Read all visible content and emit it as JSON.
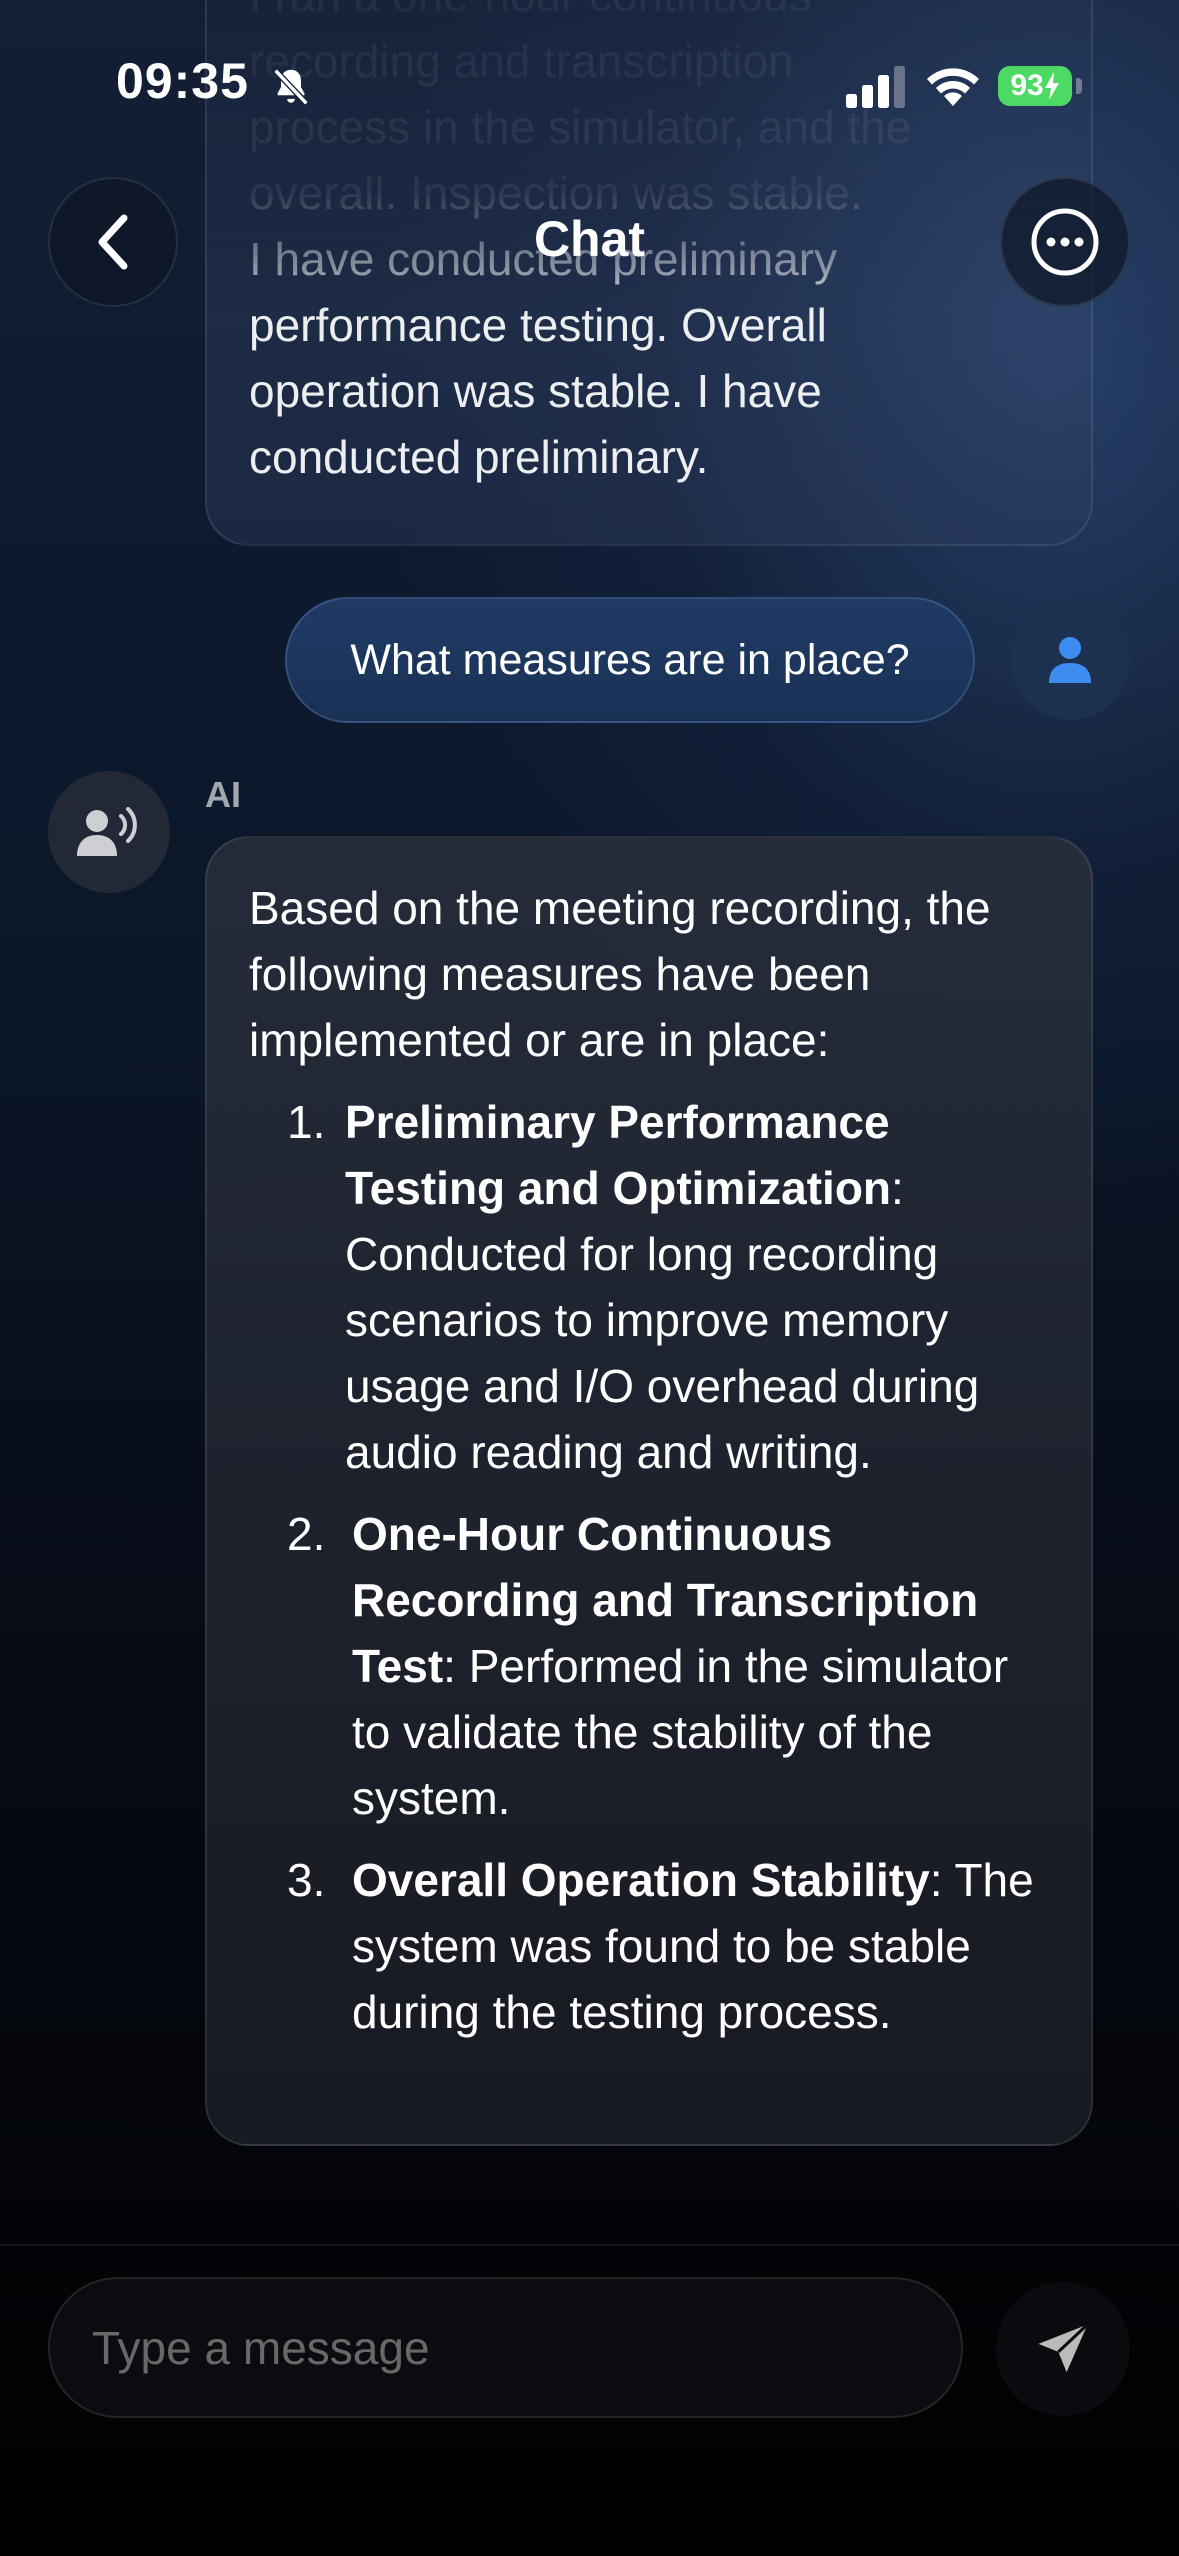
{
  "status_bar": {
    "time": "09:35",
    "battery_level": "93"
  },
  "header": {
    "title": "Chat",
    "back_icon": "chevron-left-icon",
    "more_icon": "more-horizontal-icon"
  },
  "messages": {
    "previous_ai_fragment": {
      "lines": [
        "I ran a one-hour continuous",
        "recording and transcription",
        "process in the simulator, and the",
        "overall. Inspection was stable.",
        "I have conducted preliminary",
        "performance testing. Overall",
        "operation was stable. I have",
        "conducted preliminary."
      ]
    },
    "user_message": {
      "text": "What measures are in place?",
      "avatar_icon": "user-icon"
    },
    "ai_message": {
      "sender_label": "AI",
      "avatar_icon": "voice-speaker-icon",
      "intro": "Based on the meeting recording, the following measures have been implemented or are in place:",
      "items": [
        {
          "number": "1.",
          "title": "Preliminary Performance Testing and Optimization",
          "text": "Conducted for long recording scenarios to improve memory usage and I/O overhead during audio reading and writing."
        },
        {
          "number": "2.",
          "title": "One-Hour Continuous Recording and Transcription Test",
          "text": "Performed in the simulator to validate the stability of the system."
        },
        {
          "number": "3.",
          "title": "Overall Operation Stability",
          "text": "The system was found to be stable during the testing process."
        }
      ]
    }
  },
  "composer": {
    "placeholder": "Type a message",
    "send_icon": "send-icon"
  },
  "colors": {
    "user_bubble": "#1f3b66",
    "accent_blue": "#3f8cf0",
    "battery_green": "#4cd964"
  }
}
